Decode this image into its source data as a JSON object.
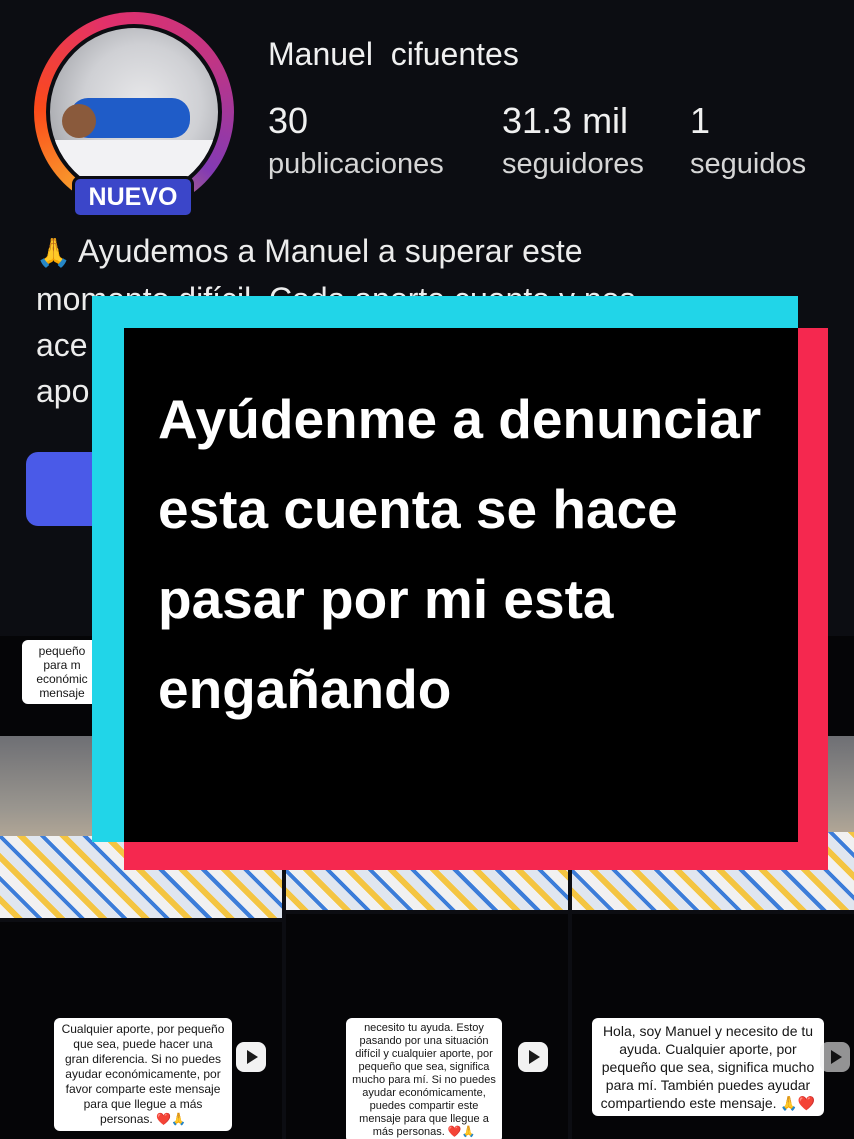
{
  "profile": {
    "username": "Manuel  cifuentes",
    "badge": "NUEVO",
    "stats": [
      {
        "count": "30",
        "label": "publicaciones"
      },
      {
        "count": "31.3 mil",
        "label": "seguidores"
      },
      {
        "count": "1",
        "label": "seguidos"
      }
    ],
    "bio_icon": "🙏",
    "bio_visible_line": "Ayudemos a Manuel a superar este",
    "bio_partial_lines": [
      "momento difícil. Cada aporte cuenta y nos",
      "ace",
      "apo"
    ]
  },
  "overlay": {
    "text": "Ayúdenme a denunciar esta cuenta se hace pasar por mi esta engañando"
  },
  "posts": {
    "top_left_caption": [
      "pequeño",
      "para m",
      "económic",
      "mensaje"
    ],
    "bottom_left_caption": "Cualquier aporte, por pequeño que sea, puede hacer una gran diferencia. Si no puedes ayudar económicamente, por favor comparte este mensaje para que llegue a más personas. ❤️🙏",
    "bottom_center_caption": "necesito tu ayuda. Estoy pasando por una situación difícil y cualquier aporte, por pequeño que sea, significa mucho para mí. Si no puedes ayudar económicamente, puedes compartir este mensaje para que llegue a más personas. ❤️🙏",
    "bottom_right_caption": "Hola, soy Manuel y necesito de tu ayuda. Cualquier aporte, por pequeño que sea, significa mucho para mí. También puedes ayudar compartiendo este mensaje. 🙏❤️"
  },
  "colors": {
    "background": "#0c0d12",
    "badge": "#3b46c9",
    "overlay_cyan": "#21d5e8",
    "overlay_red": "#f5284f",
    "overlay_black": "#000000"
  }
}
